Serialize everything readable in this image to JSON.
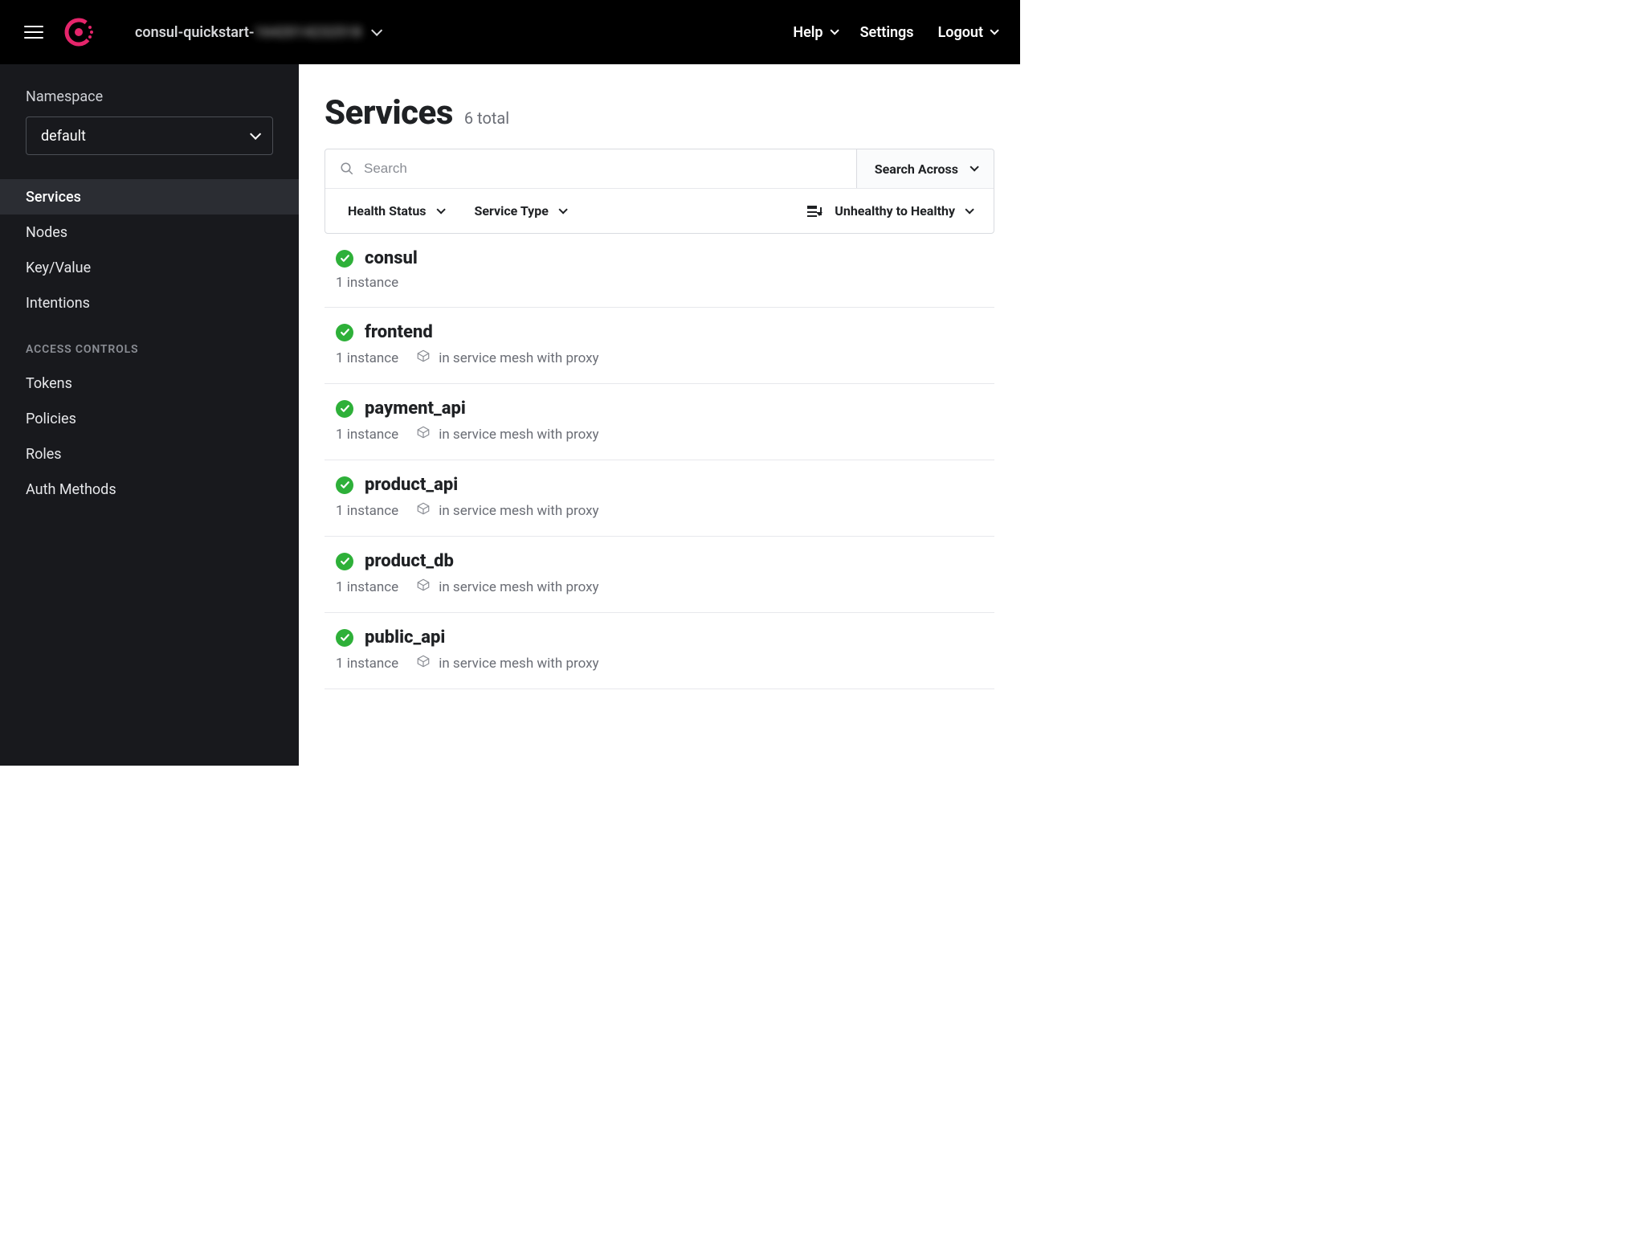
{
  "header": {
    "cluster_prefix": "consul-quickstart-",
    "cluster_suffix_masked": "1642014232518",
    "nav": {
      "help": "Help",
      "settings": "Settings",
      "logout": "Logout"
    }
  },
  "sidebar": {
    "namespace_label": "Namespace",
    "namespace_value": "default",
    "items": [
      {
        "label": "Services",
        "active": true
      },
      {
        "label": "Nodes"
      },
      {
        "label": "Key/Value"
      },
      {
        "label": "Intentions"
      }
    ],
    "section_label": "ACCESS CONTROLS",
    "access_items": [
      {
        "label": "Tokens"
      },
      {
        "label": "Policies"
      },
      {
        "label": "Roles"
      },
      {
        "label": "Auth Methods"
      }
    ]
  },
  "main": {
    "title": "Services",
    "count_label": "6 total",
    "search_placeholder": "Search",
    "search_across_label": "Search Across",
    "filters": {
      "health_status": "Health Status",
      "service_type": "Service Type",
      "sort": "Unhealthy to Healthy"
    },
    "mesh_label": "in service mesh with proxy",
    "services": [
      {
        "name": "consul",
        "instances": "1 instance",
        "mesh": false
      },
      {
        "name": "frontend",
        "instances": "1 instance",
        "mesh": true
      },
      {
        "name": "payment_api",
        "instances": "1 instance",
        "mesh": true
      },
      {
        "name": "product_api",
        "instances": "1 instance",
        "mesh": true
      },
      {
        "name": "product_db",
        "instances": "1 instance",
        "mesh": true
      },
      {
        "name": "public_api",
        "instances": "1 instance",
        "mesh": true
      }
    ]
  }
}
